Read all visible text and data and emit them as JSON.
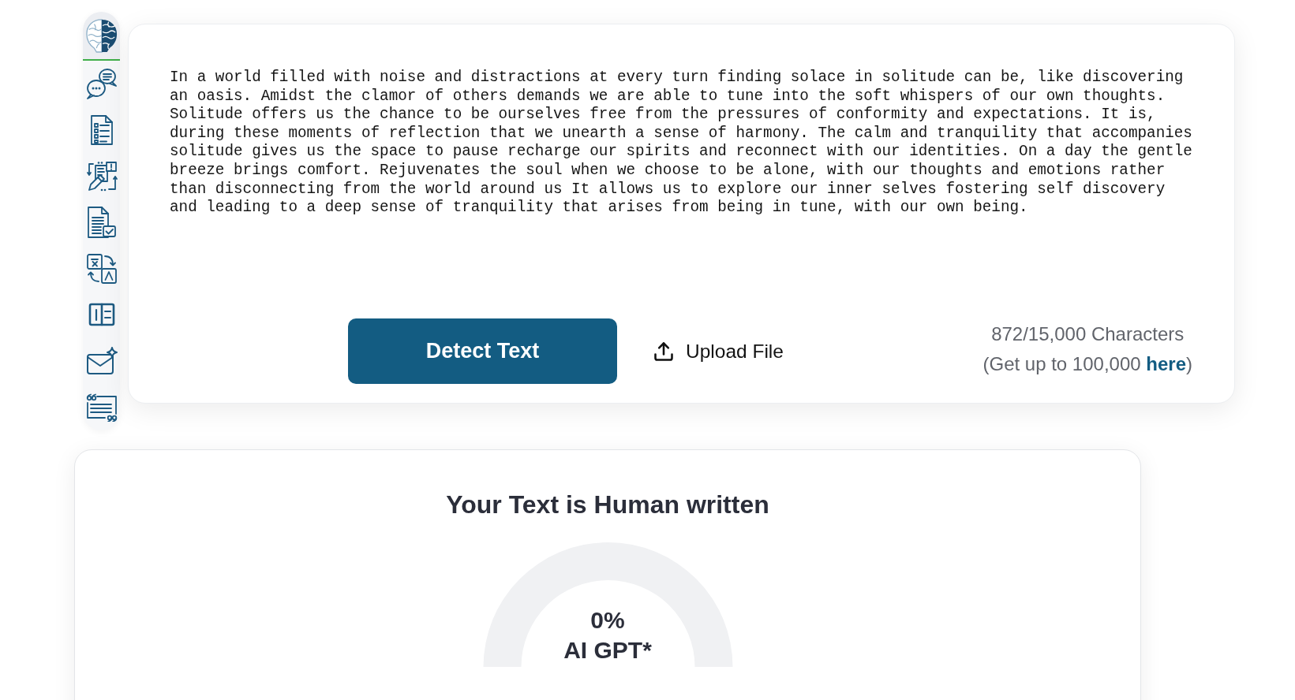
{
  "sidebar": {
    "items": [
      {
        "kind": "chat"
      },
      {
        "kind": "checklist"
      },
      {
        "kind": "flowchart"
      },
      {
        "kind": "doccheck"
      },
      {
        "kind": "translate"
      },
      {
        "kind": "panel"
      },
      {
        "kind": "mail"
      },
      {
        "kind": "quote"
      }
    ]
  },
  "editor": {
    "text": "In a world filled with noise and distractions at every turn finding solace in solitude can be, like discovering an oasis. Amidst the clamor of others demands we are able to tune into the soft whispers of our own thoughts. Solitude offers us the chance to be ourselves free from the pressures of conformity and expectations. It is, during these moments of reflection that we unearth a sense of harmony. The calm and tranquility that accompanies solitude gives us the space to pause recharge our spirits and reconnect with our identities. On a day the gentle breeze brings comfort. Rejuvenates the soul when we choose to be alone, with our thoughts and emotions rather than disconnecting from the world around us It allows us to explore our inner selves fostering self discovery and leading to a deep sense of tranquility that arises from being in tune, with our own being.",
    "detect_button": "Detect Text",
    "upload_button": "Upload File",
    "character_count": "872/15,000 Characters",
    "upgrade": {
      "before": "(Get up to 100,000",
      "link": "here",
      "after": ")"
    }
  },
  "result": {
    "title": "Your Text is Human written",
    "gauge": {
      "value": "0%",
      "label": "AI GPT*"
    }
  }
}
